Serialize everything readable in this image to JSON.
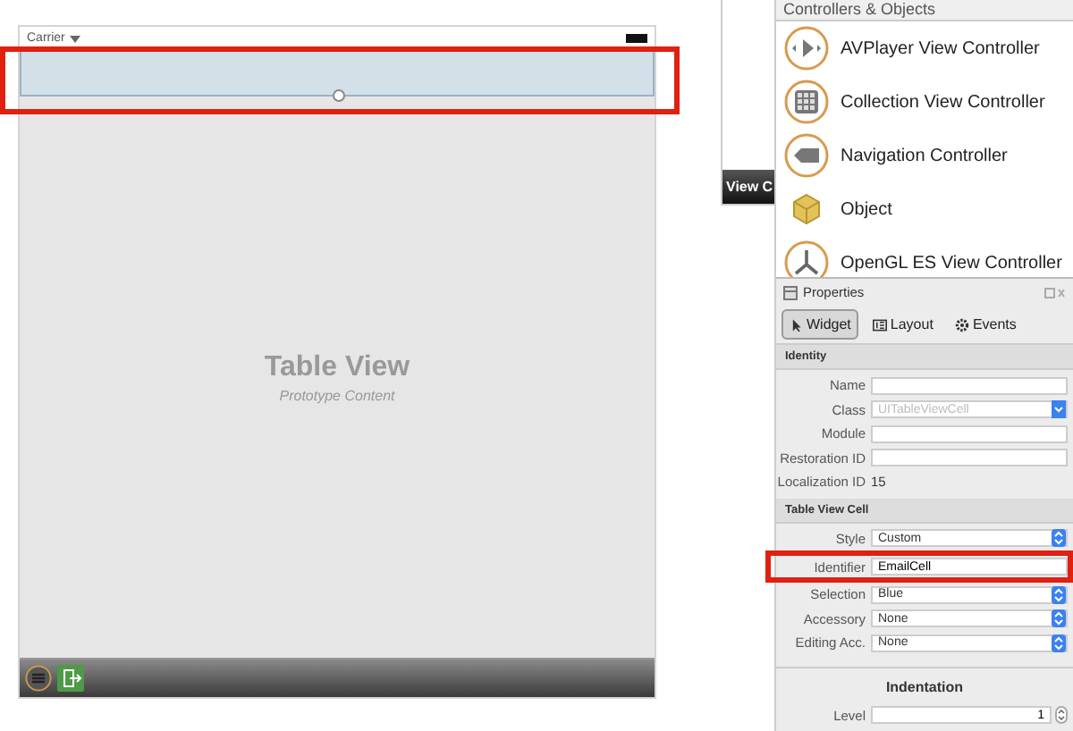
{
  "scene": {
    "status_bar": {
      "carrier": "Carrier"
    },
    "cell": {
      "selected": true,
      "highlighted": true
    },
    "table_view": {
      "title": "Table View",
      "subtitle": "Prototype Content"
    }
  },
  "side_label": "View C",
  "library": {
    "title": "Controllers & Objects",
    "items": [
      {
        "label": "AVPlayer View Controller",
        "kind": "player"
      },
      {
        "label": "Collection View Controller",
        "kind": "grid"
      },
      {
        "label": "Navigation Controller",
        "kind": "nav"
      },
      {
        "label": "Object",
        "kind": "cube"
      },
      {
        "label": "OpenGL ES View Controller",
        "kind": "opengl"
      }
    ]
  },
  "properties": {
    "title": "Properties",
    "tabs": [
      {
        "label": "Widget",
        "selected": true,
        "kind": "widget"
      },
      {
        "label": "Layout",
        "selected": false,
        "kind": "layout"
      },
      {
        "label": "Events",
        "selected": false,
        "kind": "events"
      }
    ],
    "sections": [
      {
        "title": "Identity",
        "kind": "bar",
        "rows": [
          {
            "label": "Name",
            "kind": "text"
          },
          {
            "label": "Class",
            "kind": "combo",
            "placeholder": "UITableViewCell"
          },
          {
            "label": "Module",
            "kind": "text"
          },
          {
            "label": "Restoration ID",
            "kind": "text"
          },
          {
            "label": "Localization ID",
            "kind": "static",
            "value": "15"
          }
        ]
      },
      {
        "title": "Table View Cell",
        "kind": "bar",
        "rows": [
          {
            "label": "Style",
            "kind": "popup",
            "value": "Custom"
          },
          {
            "label": "Identifier",
            "kind": "text",
            "value": "EmailCell",
            "highlighted": true
          },
          {
            "label": "Selection",
            "kind": "popup",
            "value": "Blue"
          },
          {
            "label": "Accessory",
            "kind": "popup",
            "value": "None"
          },
          {
            "label": "Editing Acc.",
            "kind": "popup",
            "value": "None"
          }
        ]
      },
      {
        "title": "Indentation",
        "kind": "centered",
        "rows": [
          {
            "label": "Level",
            "kind": "stepper",
            "value": "1"
          }
        ]
      }
    ]
  }
}
